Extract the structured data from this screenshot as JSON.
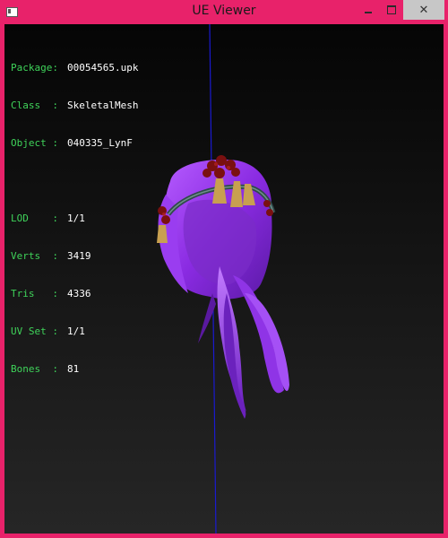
{
  "window": {
    "title": "UE Viewer",
    "minimize_glyph": "–",
    "close_glyph": "✕"
  },
  "info": {
    "package_key": "Package:",
    "package_val": "00054565.upk",
    "class_key": "Class  :",
    "class_val": "SkeletalMesh",
    "object_key": "Object :",
    "object_val": "040335_LynF",
    "lod_key": "LOD    :",
    "lod_val": "1/1",
    "verts_key": "Verts  :",
    "verts_val": "3419",
    "tris_key": "Tris   :",
    "tris_val": "4336",
    "uvset_key": "UV Set :",
    "uvset_val": "1/1",
    "bones_key": "Bones  :",
    "bones_val": "81"
  },
  "colors": {
    "window_border": "#e8226a",
    "label_green": "#3fd35a",
    "axis_blue": "#1a1ad0",
    "hair_purple": "#8a2be2"
  },
  "icons": {
    "app": "app-window-icon",
    "minimize": "minimize-icon",
    "maximize": "maximize-icon",
    "close": "close-icon"
  }
}
